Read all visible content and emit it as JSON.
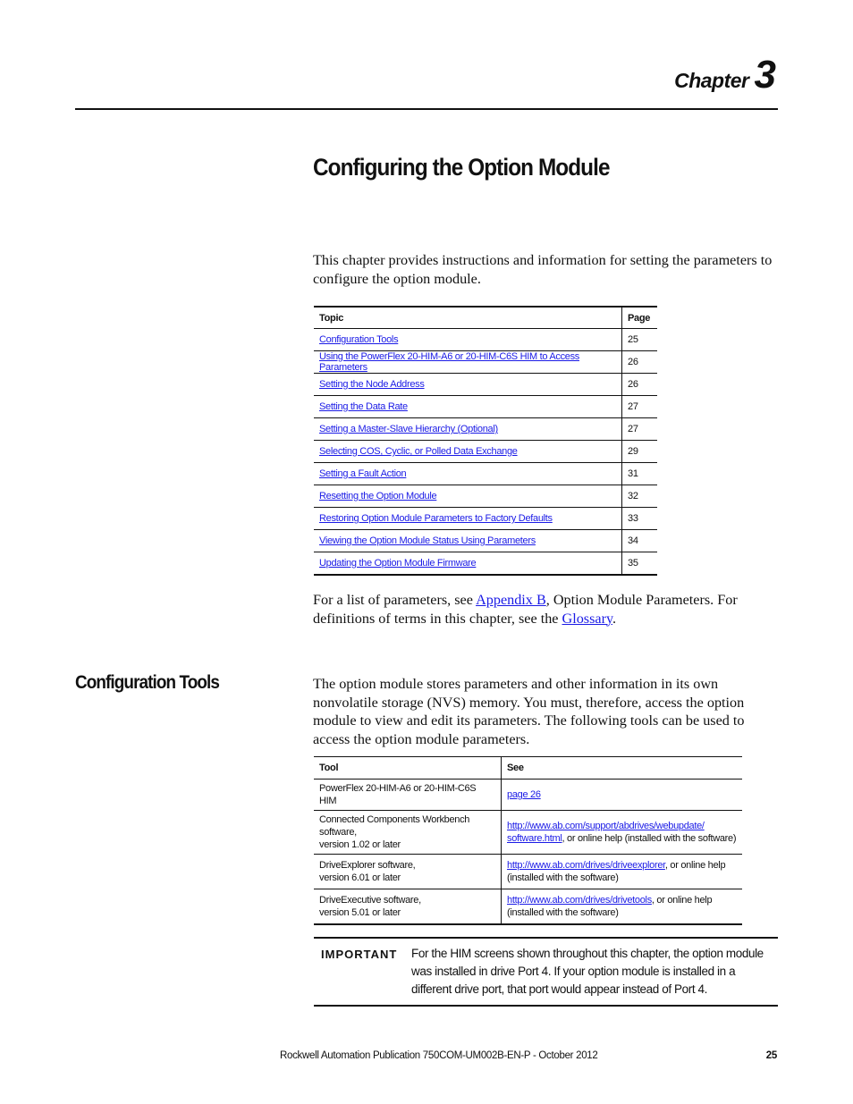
{
  "chapter": {
    "word": "Chapter",
    "number": "3"
  },
  "title": "Configuring the Option Module",
  "intro": "This chapter provides instructions and information for setting the parameters to configure the option module.",
  "topics_table": {
    "headers": [
      "Topic",
      "Page"
    ],
    "rows": [
      {
        "topic": "Configuration Tools",
        "page": "25"
      },
      {
        "topic": "Using the PowerFlex 20-HIM-A6 or 20-HIM-C6S HIM to Access Parameters",
        "page": "26"
      },
      {
        "topic": "Setting the Node Address",
        "page": "26"
      },
      {
        "topic": "Setting the Data Rate",
        "page": "27"
      },
      {
        "topic": "Setting a Master-Slave Hierarchy (Optional)",
        "page": "27"
      },
      {
        "topic": "Selecting COS, Cyclic, or Polled Data Exchange",
        "page": "29"
      },
      {
        "topic": "Setting a Fault Action",
        "page": "31"
      },
      {
        "topic": "Resetting the Option Module",
        "page": "32"
      },
      {
        "topic": "Restoring Option Module Parameters to Factory Defaults",
        "page": "33"
      },
      {
        "topic": "Viewing the Option Module Status Using Parameters",
        "page": "34"
      },
      {
        "topic": "Updating the Option Module Firmware",
        "page": "35"
      }
    ]
  },
  "references": {
    "part1": "For a list of parameters, see ",
    "appendix_link": "Appendix B",
    "part2": ", Option Module Parameters. For definitions of terms in this chapter, see the ",
    "glossary_link": "Glossary",
    "part3": "."
  },
  "section": {
    "heading": "Configuration Tools",
    "paragraph": "The option module stores parameters and other information in its own nonvolatile storage (NVS) memory. You must, therefore, access the option module to view and edit its parameters. The following tools can be used to access the option module parameters."
  },
  "tools_table": {
    "headers": [
      "Tool",
      "See"
    ],
    "rows": [
      {
        "tool_line1": "PowerFlex 20-HIM-A6 or 20-HIM-C6S HIM",
        "tool_line2": "",
        "link": "page 26",
        "link_line2": "",
        "suffix": ""
      },
      {
        "tool_line1": "Connected Components Workbench software,",
        "tool_line2": "version 1.02 or later",
        "link": "http://www.ab.com/support/abdrives/webupdate/",
        "link_line2": "software.html",
        "suffix": ", or online help (installed with the software)"
      },
      {
        "tool_line1": "DriveExplorer software,",
        "tool_line2": "version 6.01 or later",
        "link": "http://www.ab.com/drives/driveexplorer",
        "link_line2": "",
        "suffix": ", or online help (installed with the software)"
      },
      {
        "tool_line1": "DriveExecutive software,",
        "tool_line2": "version 5.01 or later",
        "link": "http://www.ab.com/drives/drivetools",
        "link_line2": "",
        "suffix": ", or online help (installed with the software)"
      }
    ]
  },
  "important": {
    "label": "IMPORTANT",
    "text": "For the HIM screens shown throughout this chapter, the option module was installed in drive Port 4. If your option module is installed in a different drive port, that port would appear instead of Port 4."
  },
  "footer": {
    "publication": "Rockwell Automation Publication 750COM-UM002B-EN-P - October 2012",
    "page_number": "25"
  },
  "colors": {
    "link": "#1a1ae6",
    "text": "#111111"
  }
}
